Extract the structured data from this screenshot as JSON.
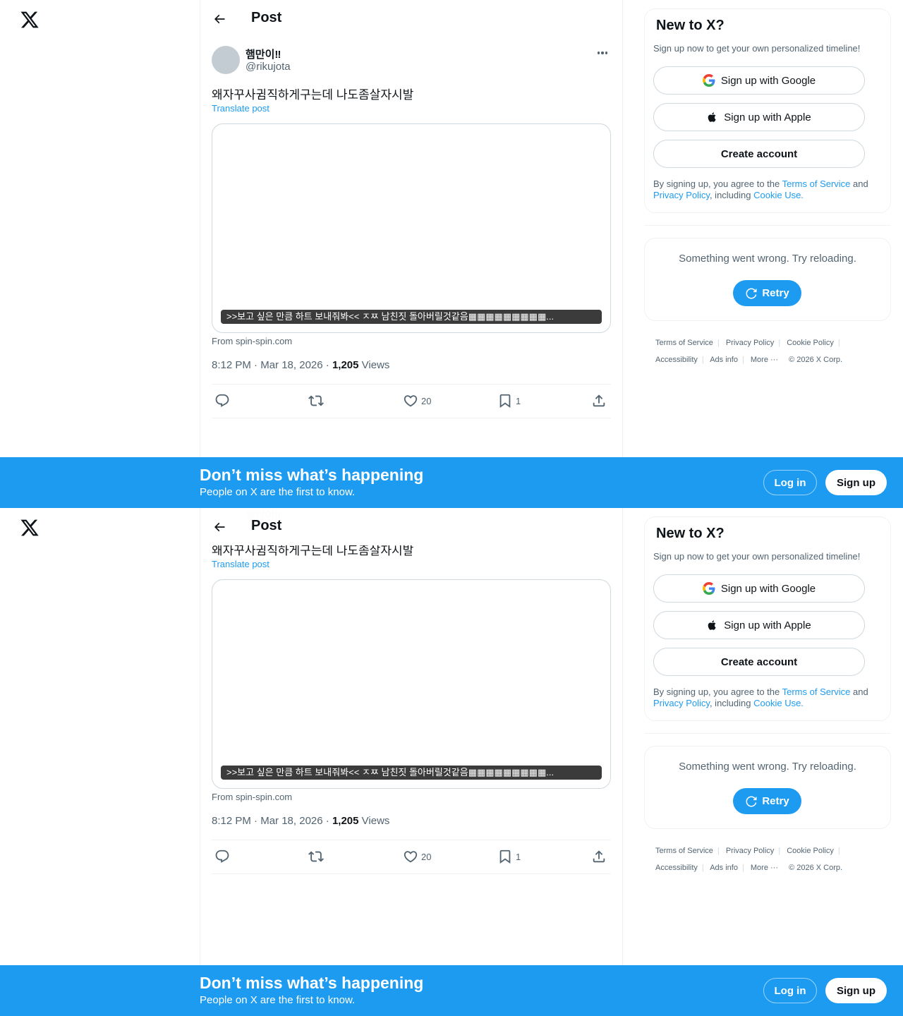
{
  "nav": {
    "logo_icon": "x-logo-icon"
  },
  "header": {
    "title": "Post",
    "back_icon": "arrow-left-icon"
  },
  "post": {
    "author_name": "햄만이‼",
    "author_handle": "@rikujota",
    "text": "왜자꾸사귐직하게구는데 나도좀살자시발",
    "translate_label": "Translate post",
    "card_caption": ">>보고 싶은 만큼 하트 보내줘봐<< ㅈㅉ 남친짓 돌아버릴것같음▦▦▦▦▦▦▦▦▦...",
    "card_source": "From spin-spin.com",
    "time": "8:12 PM",
    "date": "Mar 18, 2026",
    "views_count": "1,205",
    "views_label": "Views",
    "likes": "20",
    "bookmarks": "1"
  },
  "sidebar": {
    "signup_title": "New to X?",
    "signup_subtitle": "Sign up now to get your own personalized timeline!",
    "google_label": "Sign up with Google",
    "apple_label": "Sign up with Apple",
    "create_label": "Create account",
    "terms_prefix": "By signing up, you agree to the ",
    "terms_link": "Terms of Service",
    "terms_and": " and ",
    "privacy_link": "Privacy Policy",
    "terms_including": ", including ",
    "cookie_link": "Cookie Use.",
    "error_text": "Something went wrong. Try reloading.",
    "retry_label": "Retry"
  },
  "footer": {
    "links": [
      "Terms of Service",
      "Privacy Policy",
      "Cookie Policy",
      "Accessibility",
      "Ads info",
      "More ···"
    ],
    "copyright": "© 2026 X Corp."
  },
  "banner": {
    "title": "Don’t miss what’s happening",
    "subtitle": "People on X are the first to know.",
    "login_label": "Log in",
    "signup_label": "Sign up"
  },
  "colors": {
    "accent": "#1d9bf0",
    "text": "#0f1419",
    "muted": "#536471",
    "border": "#cfd9de"
  }
}
